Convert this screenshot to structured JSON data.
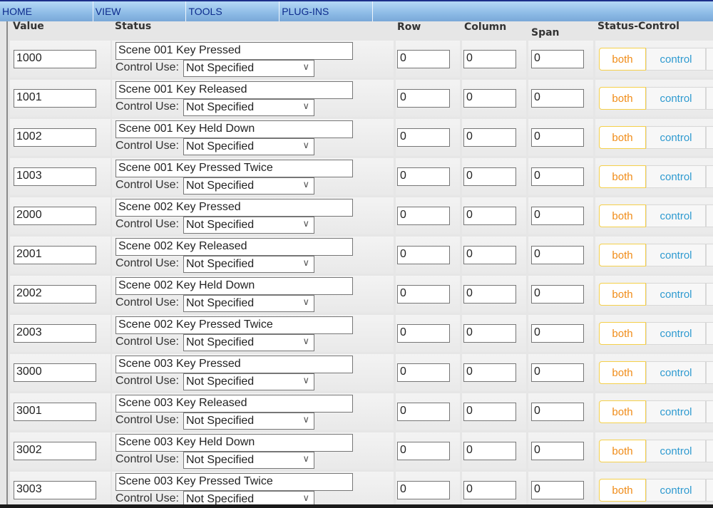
{
  "menu": [
    "HOME",
    "VIEW",
    "TOOLS",
    "PLUG-INS"
  ],
  "headers": {
    "value": "Value",
    "status": "Status",
    "row": "Row",
    "column": "Column",
    "span": "Span",
    "status_control": "Status-Control"
  },
  "control_use_label": "Control Use:",
  "buttons": {
    "both": "both",
    "control": "control"
  },
  "rows": [
    {
      "value": "1000",
      "status": "Scene 001 Key Pressed",
      "control_use": "Not Specified",
      "row": "0",
      "column": "0",
      "span": "0"
    },
    {
      "value": "1001",
      "status": "Scene 001 Key Released",
      "control_use": "Not Specified",
      "row": "0",
      "column": "0",
      "span": "0"
    },
    {
      "value": "1002",
      "status": "Scene 001 Key Held Down",
      "control_use": "Not Specified",
      "row": "0",
      "column": "0",
      "span": "0"
    },
    {
      "value": "1003",
      "status": "Scene 001 Key Pressed Twice",
      "control_use": "Not Specified",
      "row": "0",
      "column": "0",
      "span": "0"
    },
    {
      "value": "2000",
      "status": "Scene 002 Key Pressed",
      "control_use": "Not Specified",
      "row": "0",
      "column": "0",
      "span": "0"
    },
    {
      "value": "2001",
      "status": "Scene 002 Key Released",
      "control_use": "Not Specified",
      "row": "0",
      "column": "0",
      "span": "0"
    },
    {
      "value": "2002",
      "status": "Scene 002 Key Held Down",
      "control_use": "Not Specified",
      "row": "0",
      "column": "0",
      "span": "0"
    },
    {
      "value": "2003",
      "status": "Scene 002 Key Pressed Twice",
      "control_use": "Not Specified",
      "row": "0",
      "column": "0",
      "span": "0"
    },
    {
      "value": "3000",
      "status": "Scene 003 Key Pressed",
      "control_use": "Not Specified",
      "row": "0",
      "column": "0",
      "span": "0"
    },
    {
      "value": "3001",
      "status": "Scene 003 Key Released",
      "control_use": "Not Specified",
      "row": "0",
      "column": "0",
      "span": "0"
    },
    {
      "value": "3002",
      "status": "Scene 003 Key Held Down",
      "control_use": "Not Specified",
      "row": "0",
      "column": "0",
      "span": "0"
    },
    {
      "value": "3003",
      "status": "Scene 003 Key Pressed Twice",
      "control_use": "Not Specified",
      "row": "0",
      "column": "0",
      "span": "0"
    }
  ]
}
